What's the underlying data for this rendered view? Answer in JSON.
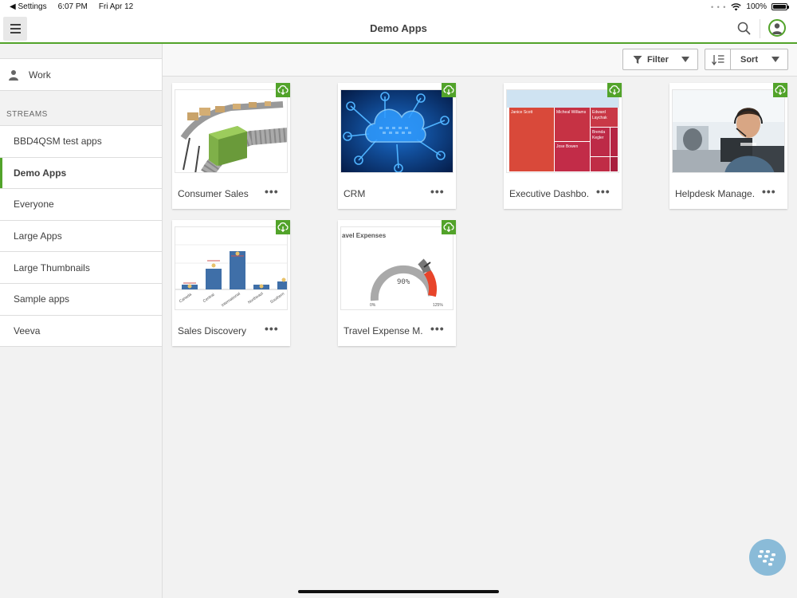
{
  "status_bar": {
    "back_label": "◀ Settings",
    "time": "6:07 PM",
    "date": "Fri Apr 12",
    "battery": "100%"
  },
  "header": {
    "title": "Demo Apps"
  },
  "sidebar": {
    "work_label": "Work",
    "streams_heading": "STREAMS",
    "streams": [
      {
        "label": "BBD4QSM test apps"
      },
      {
        "label": "Demo Apps"
      },
      {
        "label": "Everyone"
      },
      {
        "label": "Large Apps"
      },
      {
        "label": "Large Thumbnails"
      },
      {
        "label": "Sample apps"
      },
      {
        "label": "Veeva"
      }
    ]
  },
  "toolbar": {
    "filter_label": "Filter",
    "sort_label": "Sort"
  },
  "apps": [
    {
      "name": "Consumer Sales"
    },
    {
      "name": "CRM"
    },
    {
      "name": "Executive Dashbo..."
    },
    {
      "name": "Helpdesk Manage..."
    },
    {
      "name": "Sales Discovery"
    },
    {
      "name": "Travel Expense M..."
    }
  ],
  "thumbnails": {
    "exec_names": [
      "Janice Scott",
      "Micheal Williams",
      "Edward Laychak",
      "Jose Bowen",
      "Brenda Kegler"
    ],
    "sales_categories": [
      "Canada",
      "Central",
      "International",
      "Northeast",
      "Southern"
    ],
    "travel_title": "avel Expenses",
    "gauge_value": "90%",
    "gauge_min": "0%",
    "gauge_max": "125%"
  },
  "more_glyph": "•••",
  "colors": {
    "accent": "#52a32a",
    "fab": "#7fb6d6"
  }
}
